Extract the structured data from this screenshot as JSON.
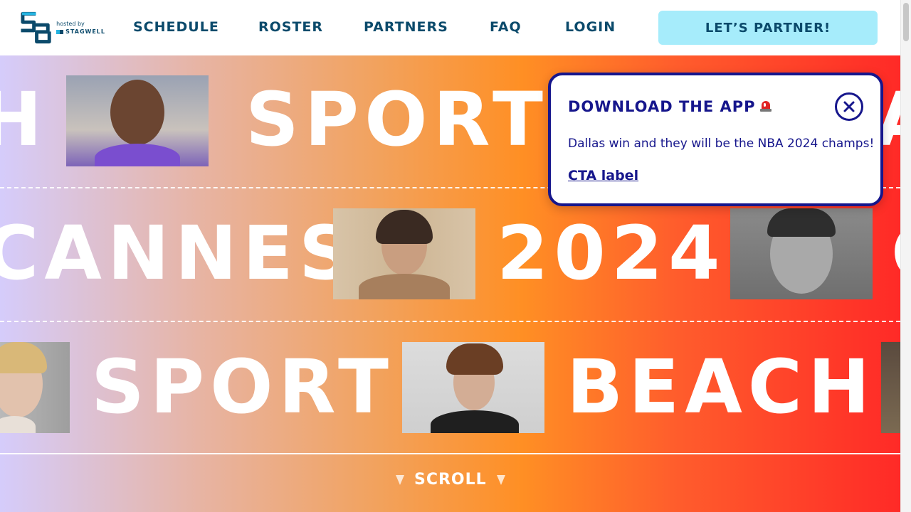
{
  "logo": {
    "monogram": "SB",
    "hosted_by": "hosted by",
    "sponsor": "STAGWELL"
  },
  "nav": {
    "items": [
      {
        "label": "SCHEDULE"
      },
      {
        "label": "ROSTER"
      },
      {
        "label": "PARTNERS"
      },
      {
        "label": "FAQ"
      },
      {
        "label": "LOGIN"
      }
    ],
    "cta_label": "LET’S PARTNER!"
  },
  "hero": {
    "row1": [
      "H",
      "SPORT",
      "A"
    ],
    "row2": [
      "CANNES",
      "2024",
      "C"
    ],
    "row3": [
      "SPORT",
      "BEACH"
    ],
    "scroll_label": "SCROLL"
  },
  "popup": {
    "title": "DOWNLOAD THE APP",
    "title_icon": "siren-icon",
    "body": "Dallas win and they will be the NBA 2024 champs!",
    "link_label": "CTA label",
    "close_icon": "close-icon"
  },
  "colors": {
    "nav_text": "#0b4a6b",
    "cta_bg": "#a6ecfb",
    "popup_accent": "#16168c",
    "gradient_start": "#d5ccfb",
    "gradient_mid": "#ff8f24",
    "gradient_end": "#ff2a27"
  }
}
